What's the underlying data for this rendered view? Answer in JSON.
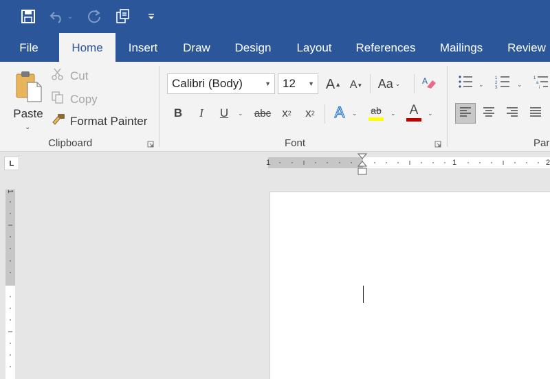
{
  "tabs": [
    "File",
    "Home",
    "Insert",
    "Draw",
    "Design",
    "Layout",
    "References",
    "Mailings",
    "Review"
  ],
  "active_tab": "Home",
  "clipboard": {
    "paste_label": "Paste",
    "cut_label": "Cut",
    "copy_label": "Copy",
    "format_painter_label": "Format Painter",
    "group_label": "Clipboard"
  },
  "font": {
    "font_name": "Calibri (Body)",
    "font_size": "12",
    "change_case_label": "Aa",
    "group_label": "Font",
    "bold": "B",
    "italic": "I",
    "underline": "U",
    "strikethrough": "abc",
    "subscript": "x",
    "subscript_mark": "2",
    "superscript": "x",
    "superscript_mark": "2",
    "grow": "A",
    "shrink": "A",
    "text_effects": "A",
    "highlight": "ab",
    "font_color": "A"
  },
  "paragraph": {
    "group_label": "Para"
  },
  "ruler": {
    "h_labels": [
      "1",
      "1",
      "2"
    ],
    "v_label": "1"
  },
  "colors": {
    "brand": "#2b579a",
    "highlight": "#ffff00",
    "font_color": "#c00000"
  }
}
